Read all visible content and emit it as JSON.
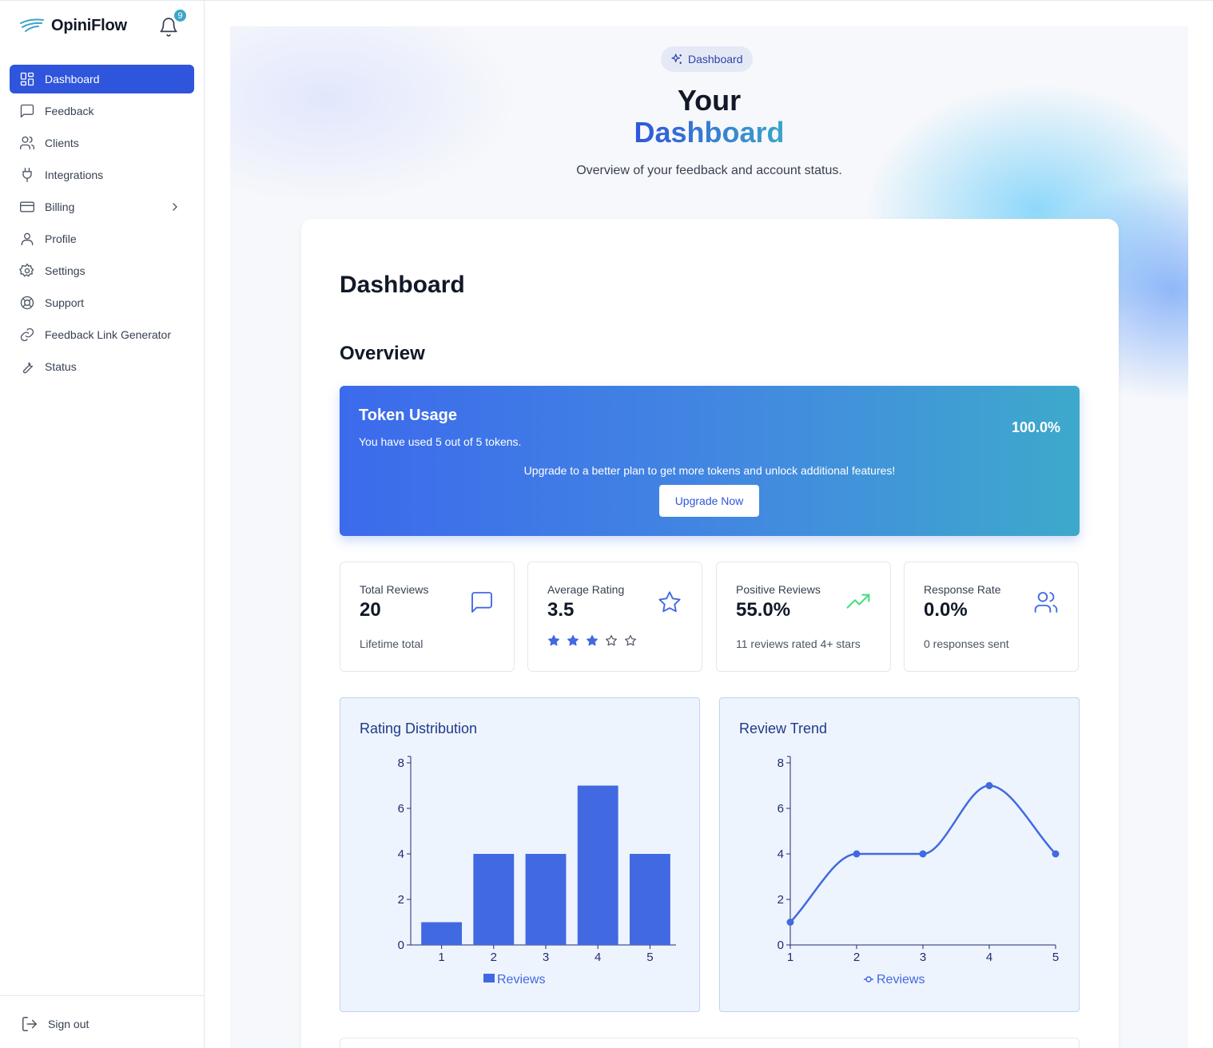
{
  "app": {
    "name": "OpiniFlow",
    "notification_count": "9"
  },
  "sidebar": {
    "items": [
      {
        "label": "Dashboard",
        "icon": "dashboard-icon",
        "active": true
      },
      {
        "label": "Feedback",
        "icon": "message-square-icon"
      },
      {
        "label": "Clients",
        "icon": "users-icon"
      },
      {
        "label": "Integrations",
        "icon": "plug-icon"
      },
      {
        "label": "Billing",
        "icon": "credit-card-icon",
        "has_submenu": true
      },
      {
        "label": "Profile",
        "icon": "user-icon"
      },
      {
        "label": "Settings",
        "icon": "gear-icon"
      },
      {
        "label": "Support",
        "icon": "life-buoy-icon"
      },
      {
        "label": "Feedback Link Generator",
        "icon": "link-icon"
      },
      {
        "label": "Status",
        "icon": "wrench-icon"
      }
    ],
    "sign_out": "Sign out"
  },
  "hero": {
    "badge": "Dashboard",
    "title_line1": "Your",
    "title_line2": "Dashboard",
    "subtitle": "Overview of your feedback and account status."
  },
  "page": {
    "title": "Dashboard",
    "section": "Overview"
  },
  "token_usage": {
    "title": "Token Usage",
    "text": "You have used 5 out of 5 tokens.",
    "percent": "100.0%",
    "upgrade_text": "Upgrade to a better plan to get more tokens and unlock additional features!",
    "button": "Upgrade Now"
  },
  "stats": [
    {
      "label": "Total Reviews",
      "value": "20",
      "sub": "Lifetime total",
      "icon": "message-square-icon"
    },
    {
      "label": "Average Rating",
      "value": "3.5",
      "stars_filled": 3,
      "stars_total": 5,
      "icon": "star-icon"
    },
    {
      "label": "Positive Reviews",
      "value": "55.0%",
      "sub": "11 reviews rated 4+ stars",
      "icon": "trending-up-icon"
    },
    {
      "label": "Response Rate",
      "value": "0.0%",
      "sub": "0 responses sent",
      "icon": "users-icon"
    }
  ],
  "colors": {
    "primary": "#2f55dc",
    "bar": "#4169e1",
    "accent_teal": "#3ba5c8",
    "trend_green": "#4ade80"
  },
  "chart_data": [
    {
      "type": "bar",
      "title": "Rating Distribution",
      "categories": [
        "1",
        "2",
        "3",
        "4",
        "5"
      ],
      "series": [
        {
          "name": "Reviews",
          "values": [
            1,
            4,
            4,
            7,
            4
          ]
        }
      ],
      "ylim": [
        0,
        8
      ],
      "yticks": [
        "0",
        "2",
        "4",
        "6",
        "8"
      ],
      "legend": "bottom"
    },
    {
      "type": "line",
      "title": "Review Trend",
      "categories": [
        "1",
        "2",
        "3",
        "4",
        "5"
      ],
      "series": [
        {
          "name": "Reviews",
          "values": [
            1,
            4,
            4,
            7,
            4
          ]
        }
      ],
      "ylim": [
        0,
        8
      ],
      "yticks": [
        "0",
        "2",
        "4",
        "6",
        "8"
      ],
      "legend": "bottom"
    }
  ]
}
